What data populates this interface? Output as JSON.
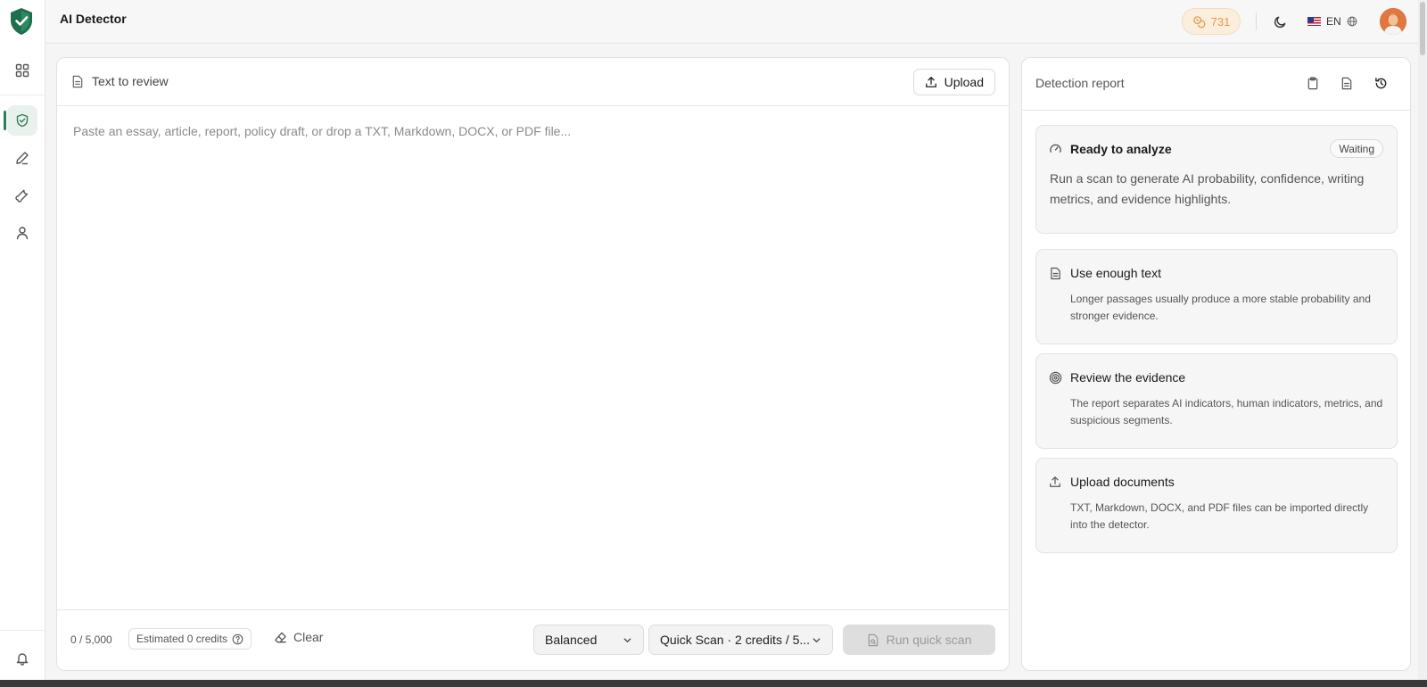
{
  "app": {
    "title": "AI Detector"
  },
  "header": {
    "credits": "731",
    "language": "EN"
  },
  "sidebar": {
    "items": [
      {
        "name": "dashboard",
        "icon": "grid-icon",
        "active": false
      },
      {
        "name": "ai-detector",
        "icon": "shield-check-icon",
        "active": true
      },
      {
        "name": "writer",
        "icon": "pen-icon",
        "active": false
      },
      {
        "name": "tools",
        "icon": "wrench-icon",
        "active": false
      },
      {
        "name": "account",
        "icon": "user-icon",
        "active": false
      }
    ],
    "bottom_icon": "bell-icon"
  },
  "editor": {
    "title": "Text to review",
    "upload_label": "Upload",
    "placeholder": "Paste an essay, article, report, policy draft, or drop a TXT, Markdown, DOCX, or PDF file...",
    "char_count": "0 / 5,000",
    "estimated_credits": "Estimated 0 credits",
    "clear_label": "Clear",
    "mode_value": "Balanced",
    "scan_value": "Quick Scan · 2 credits / 5...",
    "run_label": "Run quick scan"
  },
  "report": {
    "title": "Detection report",
    "ready": {
      "title": "Ready to analyze",
      "badge": "Waiting",
      "body": "Run a scan to generate AI probability, confidence, writing metrics, and evidence highlights."
    },
    "tips": [
      {
        "title": "Use enough text",
        "body": "Longer passages usually produce a more stable probability and stronger evidence.",
        "icon": "document-icon"
      },
      {
        "title": "Review the evidence",
        "body": "The report separates AI indicators, human indicators, metrics, and suspicious segments.",
        "icon": "target-icon"
      },
      {
        "title": "Upload documents",
        "body": "TXT, Markdown, DOCX, and PDF files can be imported directly into the detector.",
        "icon": "upload-icon"
      }
    ]
  },
  "colors": {
    "brand": "#2e7d5b",
    "credits": "#e19a4c"
  }
}
